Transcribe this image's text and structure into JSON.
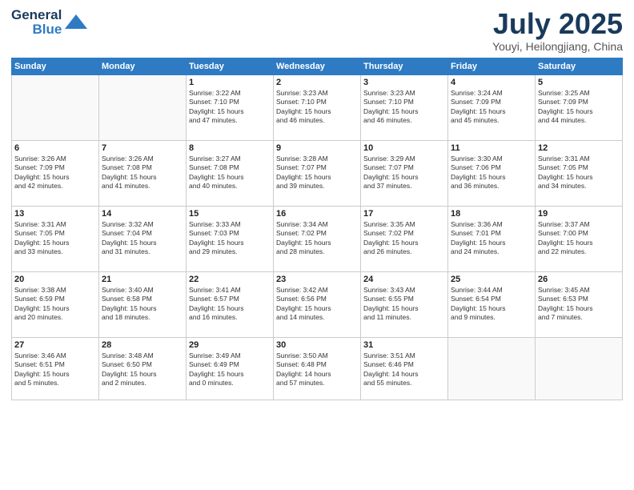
{
  "logo": {
    "line1": "General",
    "line2": "Blue"
  },
  "title": {
    "month": "July 2025",
    "location": "Youyi, Heilongjiang, China"
  },
  "days_header": [
    "Sunday",
    "Monday",
    "Tuesday",
    "Wednesday",
    "Thursday",
    "Friday",
    "Saturday"
  ],
  "weeks": [
    [
      {
        "day": "",
        "info": ""
      },
      {
        "day": "",
        "info": ""
      },
      {
        "day": "1",
        "info": "Sunrise: 3:22 AM\nSunset: 7:10 PM\nDaylight: 15 hours\nand 47 minutes."
      },
      {
        "day": "2",
        "info": "Sunrise: 3:23 AM\nSunset: 7:10 PM\nDaylight: 15 hours\nand 46 minutes."
      },
      {
        "day": "3",
        "info": "Sunrise: 3:23 AM\nSunset: 7:10 PM\nDaylight: 15 hours\nand 46 minutes."
      },
      {
        "day": "4",
        "info": "Sunrise: 3:24 AM\nSunset: 7:09 PM\nDaylight: 15 hours\nand 45 minutes."
      },
      {
        "day": "5",
        "info": "Sunrise: 3:25 AM\nSunset: 7:09 PM\nDaylight: 15 hours\nand 44 minutes."
      }
    ],
    [
      {
        "day": "6",
        "info": "Sunrise: 3:26 AM\nSunset: 7:09 PM\nDaylight: 15 hours\nand 42 minutes."
      },
      {
        "day": "7",
        "info": "Sunrise: 3:26 AM\nSunset: 7:08 PM\nDaylight: 15 hours\nand 41 minutes."
      },
      {
        "day": "8",
        "info": "Sunrise: 3:27 AM\nSunset: 7:08 PM\nDaylight: 15 hours\nand 40 minutes."
      },
      {
        "day": "9",
        "info": "Sunrise: 3:28 AM\nSunset: 7:07 PM\nDaylight: 15 hours\nand 39 minutes."
      },
      {
        "day": "10",
        "info": "Sunrise: 3:29 AM\nSunset: 7:07 PM\nDaylight: 15 hours\nand 37 minutes."
      },
      {
        "day": "11",
        "info": "Sunrise: 3:30 AM\nSunset: 7:06 PM\nDaylight: 15 hours\nand 36 minutes."
      },
      {
        "day": "12",
        "info": "Sunrise: 3:31 AM\nSunset: 7:05 PM\nDaylight: 15 hours\nand 34 minutes."
      }
    ],
    [
      {
        "day": "13",
        "info": "Sunrise: 3:31 AM\nSunset: 7:05 PM\nDaylight: 15 hours\nand 33 minutes."
      },
      {
        "day": "14",
        "info": "Sunrise: 3:32 AM\nSunset: 7:04 PM\nDaylight: 15 hours\nand 31 minutes."
      },
      {
        "day": "15",
        "info": "Sunrise: 3:33 AM\nSunset: 7:03 PM\nDaylight: 15 hours\nand 29 minutes."
      },
      {
        "day": "16",
        "info": "Sunrise: 3:34 AM\nSunset: 7:02 PM\nDaylight: 15 hours\nand 28 minutes."
      },
      {
        "day": "17",
        "info": "Sunrise: 3:35 AM\nSunset: 7:02 PM\nDaylight: 15 hours\nand 26 minutes."
      },
      {
        "day": "18",
        "info": "Sunrise: 3:36 AM\nSunset: 7:01 PM\nDaylight: 15 hours\nand 24 minutes."
      },
      {
        "day": "19",
        "info": "Sunrise: 3:37 AM\nSunset: 7:00 PM\nDaylight: 15 hours\nand 22 minutes."
      }
    ],
    [
      {
        "day": "20",
        "info": "Sunrise: 3:38 AM\nSunset: 6:59 PM\nDaylight: 15 hours\nand 20 minutes."
      },
      {
        "day": "21",
        "info": "Sunrise: 3:40 AM\nSunset: 6:58 PM\nDaylight: 15 hours\nand 18 minutes."
      },
      {
        "day": "22",
        "info": "Sunrise: 3:41 AM\nSunset: 6:57 PM\nDaylight: 15 hours\nand 16 minutes."
      },
      {
        "day": "23",
        "info": "Sunrise: 3:42 AM\nSunset: 6:56 PM\nDaylight: 15 hours\nand 14 minutes."
      },
      {
        "day": "24",
        "info": "Sunrise: 3:43 AM\nSunset: 6:55 PM\nDaylight: 15 hours\nand 11 minutes."
      },
      {
        "day": "25",
        "info": "Sunrise: 3:44 AM\nSunset: 6:54 PM\nDaylight: 15 hours\nand 9 minutes."
      },
      {
        "day": "26",
        "info": "Sunrise: 3:45 AM\nSunset: 6:53 PM\nDaylight: 15 hours\nand 7 minutes."
      }
    ],
    [
      {
        "day": "27",
        "info": "Sunrise: 3:46 AM\nSunset: 6:51 PM\nDaylight: 15 hours\nand 5 minutes."
      },
      {
        "day": "28",
        "info": "Sunrise: 3:48 AM\nSunset: 6:50 PM\nDaylight: 15 hours\nand 2 minutes."
      },
      {
        "day": "29",
        "info": "Sunrise: 3:49 AM\nSunset: 6:49 PM\nDaylight: 15 hours\nand 0 minutes."
      },
      {
        "day": "30",
        "info": "Sunrise: 3:50 AM\nSunset: 6:48 PM\nDaylight: 14 hours\nand 57 minutes."
      },
      {
        "day": "31",
        "info": "Sunrise: 3:51 AM\nSunset: 6:46 PM\nDaylight: 14 hours\nand 55 minutes."
      },
      {
        "day": "",
        "info": ""
      },
      {
        "day": "",
        "info": ""
      }
    ]
  ]
}
